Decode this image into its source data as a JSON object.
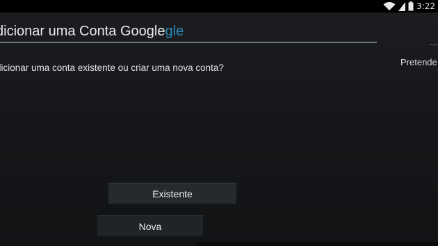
{
  "status_bar": {
    "time": "3:22",
    "icons": [
      "wifi-icon",
      "signal-icon",
      "battery-icon"
    ]
  },
  "dialog": {
    "title_prefix": "dicionar uma Conta Google",
    "title_accent": "gle",
    "question": "dicionar uma conta existente ou criar uma nova conta?",
    "side_text": "Pretende"
  },
  "buttons": {
    "existing_label": "Existente",
    "new_label": "Nova"
  },
  "colors": {
    "accent": "#2c9fd7",
    "background": "#15171a",
    "button": "#26292d"
  }
}
